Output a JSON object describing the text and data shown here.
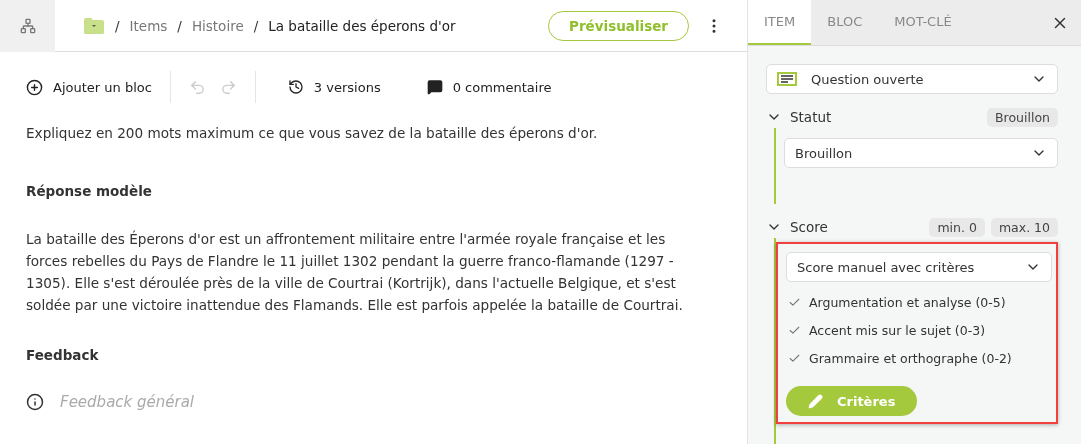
{
  "header": {
    "breadcrumb": [
      {
        "separator": "/",
        "label": "Items",
        "current": false
      },
      {
        "separator": "/",
        "label": "Histoire",
        "current": false
      },
      {
        "separator": "/",
        "label": "La bataille des éperons d'or",
        "current": true
      }
    ],
    "preview_button": "Prévisualiser"
  },
  "toolbar": {
    "add_block": "Ajouter un bloc",
    "undo_disabled": true,
    "redo_disabled": true,
    "versions": "3 versions",
    "comments": "0 commentaire"
  },
  "content": {
    "question": "Expliquez en 200 mots maximum ce que vous savez de la bataille des éperons d'or.",
    "model_answer_heading": "Réponse modèle",
    "model_answer": "La bataille des Éperons d'or est un affrontement militaire entre l'armée royale française et les forces rebelles du Pays de Flandre le 11 juillet 1302 pendant la guerre franco-flamande (1297 - 1305). Elle s'est déroulée près de la ville de Courtrai (Kortrijk), dans l'actuelle Belgique, et s'est soldée par une victoire inattendue des Flamands. Elle est parfois appelée la bataille de Courtrai.",
    "feedback_heading": "Feedback",
    "feedback_placeholder": "Feedback général"
  },
  "side_panel": {
    "tabs": [
      {
        "label": "ITEM",
        "selected": true
      },
      {
        "label": "BLOC",
        "selected": false
      },
      {
        "label": "MOT-CLÉ",
        "selected": false
      }
    ],
    "item_type": "Question ouverte",
    "status": {
      "label": "Statut",
      "expanded": true,
      "badge": "Brouillon",
      "value": "Brouillon"
    },
    "score": {
      "label": "Score",
      "expanded": true,
      "min": "min. 0",
      "max": "max. 10",
      "mode": "Score manuel avec critères",
      "highlighted": true,
      "criteria": [
        {
          "label": "Argumentation et analyse (0-5)",
          "checked": true
        },
        {
          "label": "Accent mis sur le sujet (0-3)",
          "checked": true
        },
        {
          "label": "Grammaire et orthographe (0-2)",
          "checked": true
        }
      ],
      "criteria_button": "Critères"
    }
  }
}
